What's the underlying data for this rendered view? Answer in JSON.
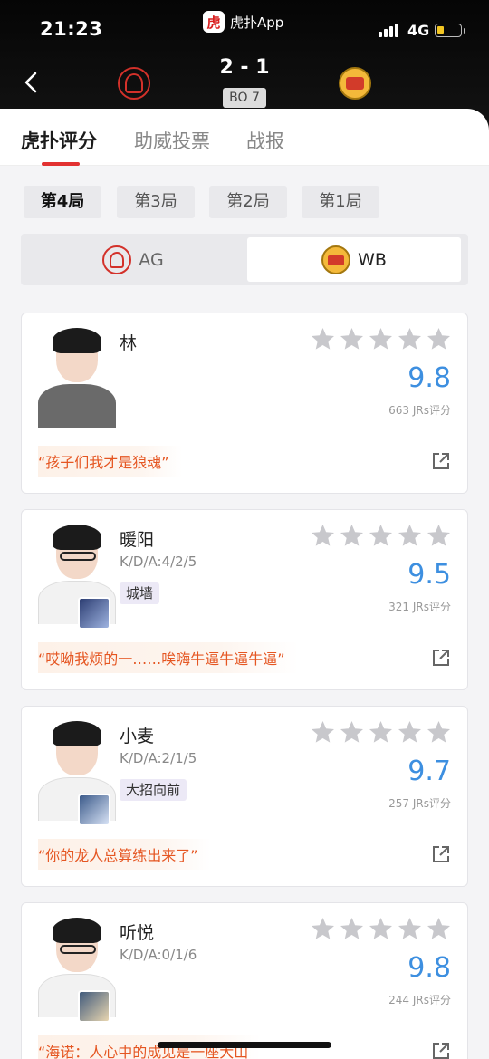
{
  "status_bar": {
    "time": "21:23",
    "app_name": "虎扑App",
    "app_logo_char": "虎",
    "network": "4G"
  },
  "match": {
    "score": "2 - 1",
    "format": "BO 7",
    "team_left": "AG",
    "team_right": "WB"
  },
  "tabs": [
    {
      "label": "虎扑评分"
    },
    {
      "label": "助威投票"
    },
    {
      "label": "战报"
    }
  ],
  "rounds": [
    {
      "label": "第4局"
    },
    {
      "label": "第3局"
    },
    {
      "label": "第2局"
    },
    {
      "label": "第1局"
    }
  ],
  "team_toggle": {
    "left": "AG",
    "right": "WB",
    "selected": "WB"
  },
  "players": [
    {
      "name": "林",
      "kda": "",
      "tag": "",
      "rating": "9.8",
      "ratings_count": "663 JRs评分",
      "quote": "“孩子们我才是狼魂”"
    },
    {
      "name": "暖阳",
      "kda": "K/D/A:4/2/5",
      "tag": "城墙",
      "rating": "9.5",
      "ratings_count": "321 JRs评分",
      "quote": "“哎呦我烦的一……唉嗨牛逼牛逼牛逼”"
    },
    {
      "name": "小麦",
      "kda": "K/D/A:2/1/5",
      "tag": "大招向前",
      "rating": "9.7",
      "ratings_count": "257 JRs评分",
      "quote": "“你的龙人总算练出来了”"
    },
    {
      "name": "听悦",
      "kda": "K/D/A:0/1/6",
      "tag": "",
      "rating": "9.8",
      "ratings_count": "244 JRs评分",
      "quote": "“海诺：人心中的成见是一座大山"
    }
  ],
  "colors": {
    "accent_red": "#e23131",
    "rating_blue": "#3d8fe0",
    "quote_orange": "#e55622",
    "star_gray": "#c8c8cc"
  },
  "icons": {
    "back": "chevron-left-icon",
    "share": "share-out-icon",
    "star": "star-icon"
  }
}
